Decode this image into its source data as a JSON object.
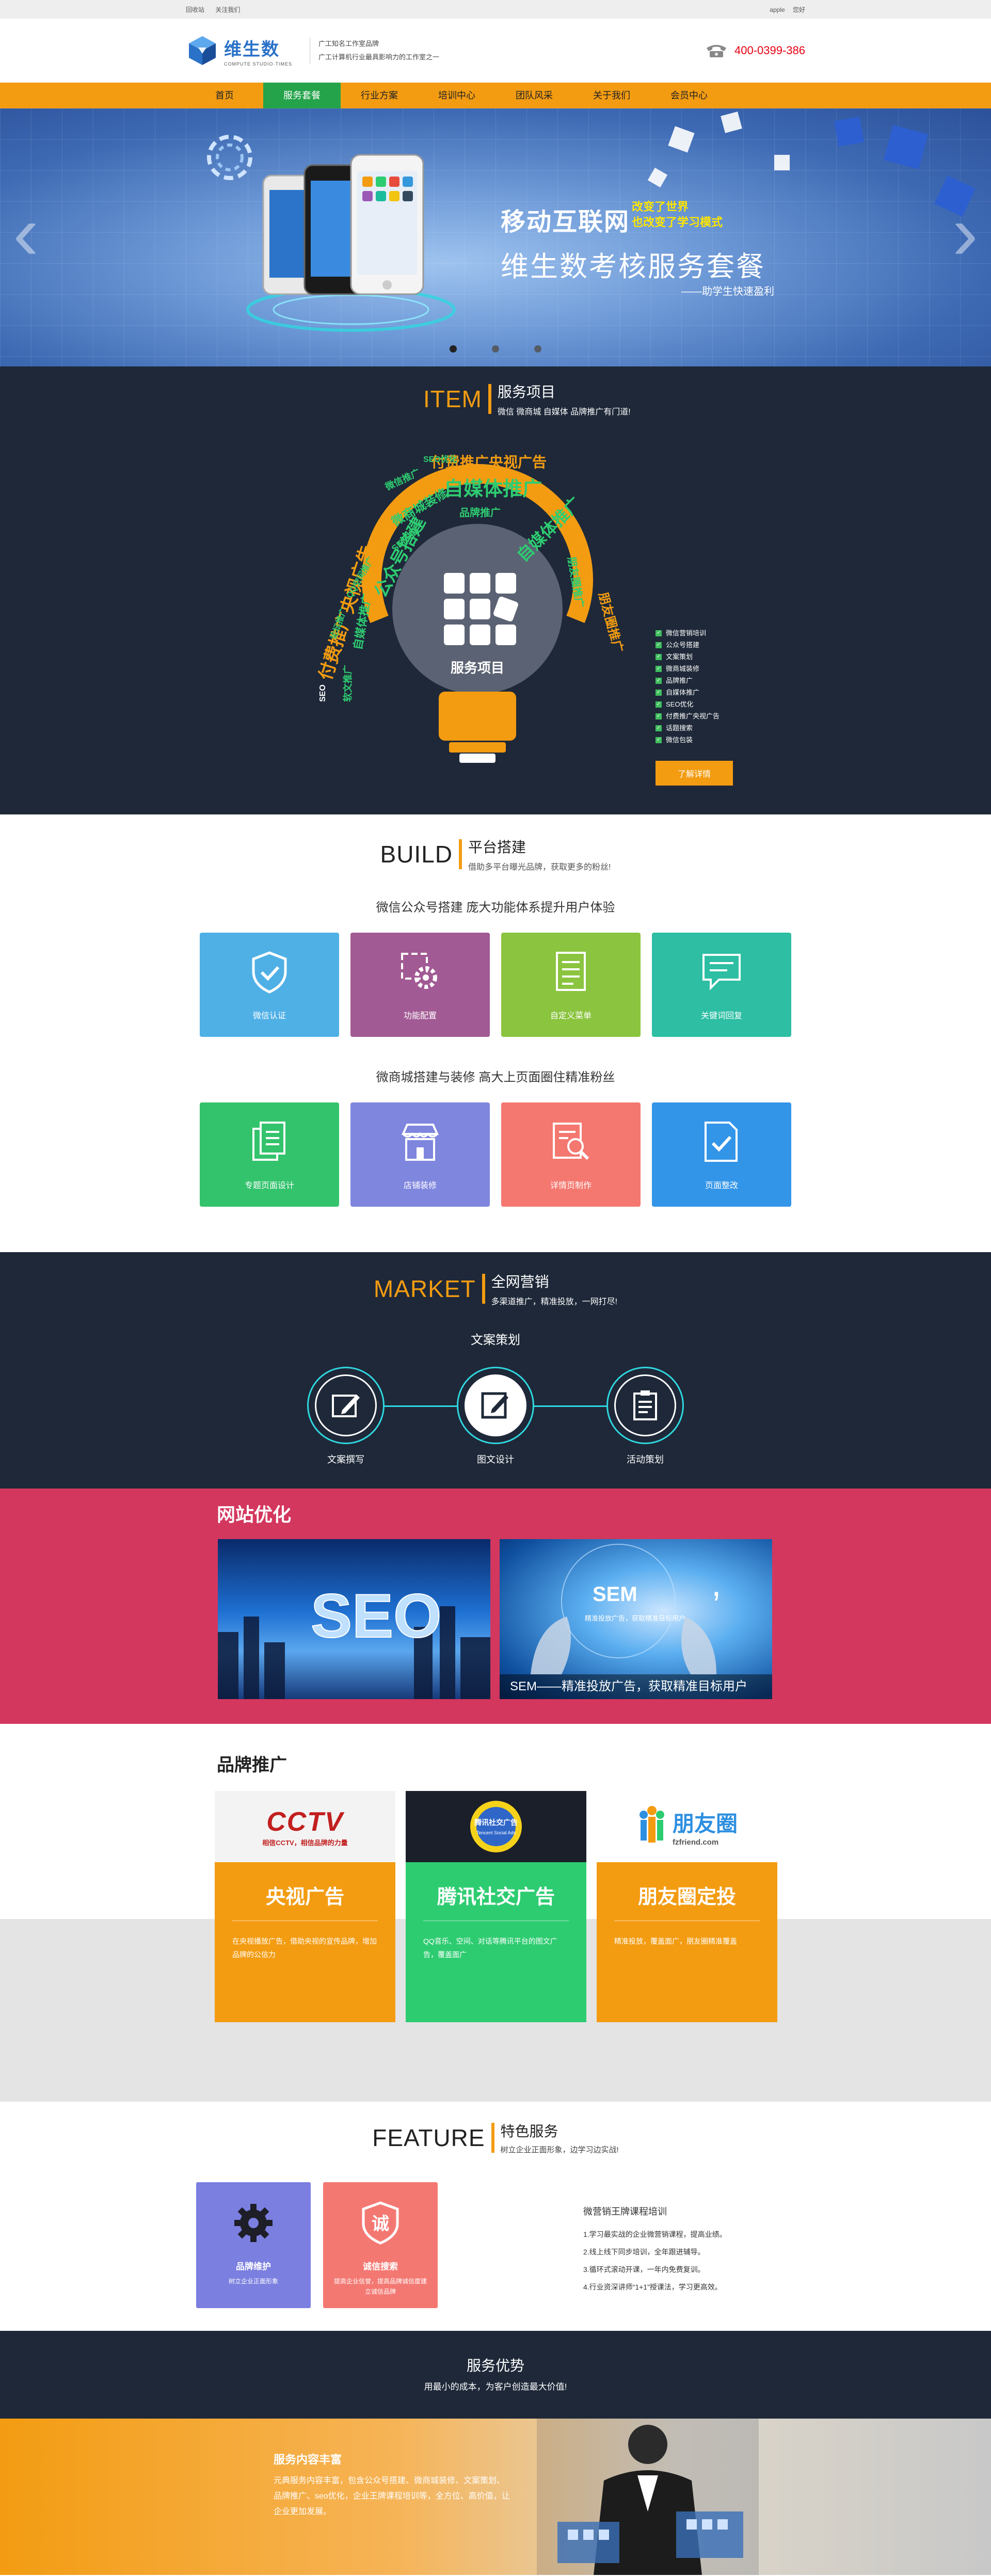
{
  "topbar": {
    "left": [
      "回收站",
      "关注我们"
    ],
    "right": [
      "apple",
      "您好"
    ]
  },
  "header": {
    "logo_cn": "维生数",
    "logo_en": "COMPUTE STUDIO·TIMES",
    "slogan_1": "广工知名工作室品牌",
    "slogan_2": "广工计算机行业最具影响力的工作室之一",
    "phone": "400-0399-386"
  },
  "nav": [
    "首页",
    "服务套餐",
    "行业方案",
    "培训中心",
    "团队风采",
    "关于我们",
    "会员中心"
  ],
  "banner": {
    "line1": "移动互联网",
    "line1b_1": "改变了世界",
    "line1b_2": "也改变了学习模式",
    "line2": "维生数考核服务套餐",
    "line3": "——助学生快速盈利",
    "prev_icon": "chevron-left-icon",
    "next_icon": "chevron-right-icon"
  },
  "item": {
    "en": "ITEM",
    "cn": "服务项目",
    "sub": "微信 微商城 自媒体 品牌推广有门道!",
    "bulb_label": "服务项目",
    "words": [
      "付费推广央视广告",
      "自媒体推广",
      "自媒体推广",
      "朋友圈推广",
      "公众号搭建",
      "微商城装修",
      "付费推广央视广告",
      "品牌推广",
      "微信推广",
      "朋友圈推广",
      "SEO优化",
      "QQ空间推广",
      "SEM推广",
      "自媒体推广",
      "SEO",
      "软文推广",
      "论坛推广"
    ],
    "list": [
      "微信营销培训",
      "公众号搭建",
      "文案策划",
      "微商城装修",
      "品牌推广",
      "自媒体推广",
      "SEO优化",
      "付费推广央视广告",
      "话题搜索",
      "微信包装"
    ],
    "button": "了解详情"
  },
  "build": {
    "en": "BUILD",
    "cn": "平台搭建",
    "sub": "借助多平台曝光品牌，获取更多的粉丝!",
    "group1_title": "微信公众号搭建 庞大功能体系提升用户体验",
    "group1": [
      {
        "label": "微信认证",
        "color": "#4fb0e6",
        "icon": "shield-check-icon"
      },
      {
        "label": "功能配置",
        "color": "#a25a94",
        "icon": "gear-icon"
      },
      {
        "label": "自定义菜单",
        "color": "#8bc43f",
        "icon": "menu-list-icon"
      },
      {
        "label": "关键词回复",
        "color": "#2dbea3",
        "icon": "chat-bubble-icon"
      }
    ],
    "group2_title": "微商城搭建与装修 高大上页面圈住精准粉丝",
    "group2": [
      {
        "label": "专题页面设计",
        "color": "#33c36c",
        "icon": "pages-icon"
      },
      {
        "label": "店铺装修",
        "color": "#7f86de",
        "icon": "store-icon"
      },
      {
        "label": "详情页制作",
        "color": "#f47870",
        "icon": "search-doc-icon"
      },
      {
        "label": "页面整改",
        "color": "#3395e8",
        "icon": "doc-check-icon"
      }
    ]
  },
  "market": {
    "en": "MARKET",
    "cn": "全网营销",
    "sub": "多渠道推广，精准投放，一网打尽!",
    "title": "文案策划",
    "items": [
      {
        "label": "文案撰写",
        "icon": "pen-write-icon"
      },
      {
        "label": "图文设计",
        "icon": "edit-icon"
      },
      {
        "label": "活动策划",
        "icon": "clipboard-icon"
      }
    ]
  },
  "optimize": {
    "title": "网站优化",
    "seo_text": "SEO",
    "sem_text": "SEM",
    "sem_tagline": "精准投放广告，获取精准目标用户",
    "sem_caption": "SEM——精准投放广告，获取精准目标用户"
  },
  "brand": {
    "title": "品牌推广",
    "cards": [
      {
        "title": "央视广告",
        "desc": "在央视播放广告，借助央视的宣传品牌，增加品牌的公信力",
        "color": "#f39c12",
        "logo": "CCTV",
        "logo_sub": "相信CCTV，相信品牌的力量"
      },
      {
        "title": "腾讯社交广告",
        "desc": "QQ音乐、空间、对话等腾讯平台的图文广告，覆盖面广",
        "color": "#2ecc71",
        "logo": "腾讯社交广告",
        "logo_sub": "Tencent Social Ads"
      },
      {
        "title": "朋友圈定投",
        "desc": "精准投放，覆盖面广，朋友圈精准覆盖",
        "color": "#f39c12",
        "logo": "朋友圈",
        "logo_sub": "fzfriend.com"
      }
    ]
  },
  "feature": {
    "en": "FEATURE",
    "cn": "特色服务",
    "sub": "树立企业正面形象，边学习边实战!",
    "boxes": [
      {
        "title": "品牌维护",
        "desc": "树立企业正面形象",
        "color": "#7b7fe0",
        "icon": "gear-icon"
      },
      {
        "title": "诚信搜索",
        "desc": "提高企业信誉，提高品牌诚信度建立诚信品牌",
        "color": "#f47872",
        "icon": "badge-icon",
        "badge": "诚"
      }
    ],
    "list_title": "微营销王牌课程培训",
    "list": [
      "1.学习最实战的企业微营销课程，提高业绩。",
      "2.线上线下同步培训，全年跟进辅导。",
      "3.循环式滚动开课，一年内免费复训。",
      "4.行业资深讲师“1+1”授课法，学习更高效。"
    ]
  },
  "advantage": {
    "title": "服务优势",
    "sub": "用最小的成本，为客户创造最大价值!"
  },
  "bottom": {
    "title": "服务内容丰富",
    "desc": "元典服务内容丰富，包含公众号搭建、微商城装修、文案策划、品牌推广、seo优化，企业王牌课程培训等，全方位、高价值，让企业更加发展。"
  },
  "colors": {
    "orange": "#f39c12",
    "green": "#24a34a",
    "dark": "#1e2838",
    "pink": "#d3375e",
    "cyan": "#2fd7e0"
  }
}
